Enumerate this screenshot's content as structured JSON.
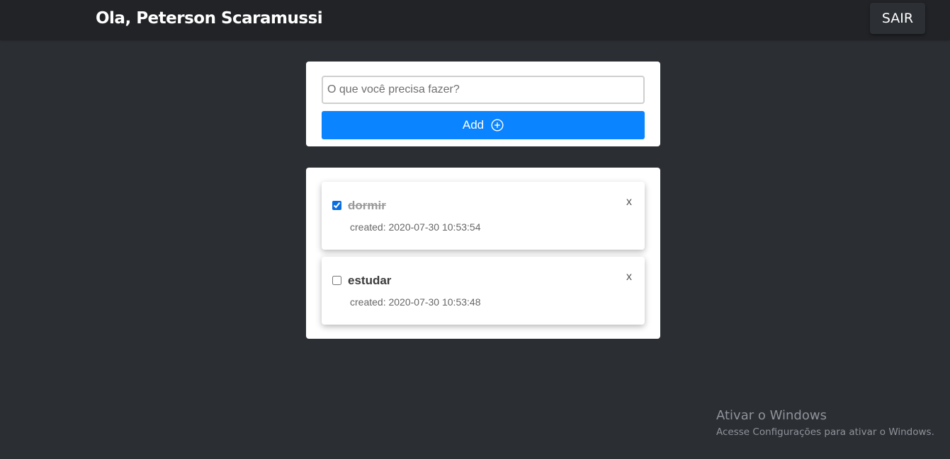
{
  "header": {
    "greeting": "Ola, Peterson Scaramussi",
    "logout_label": "SAIR"
  },
  "form": {
    "input_placeholder": "O que você precisa fazer?",
    "input_value": "",
    "add_label": "Add",
    "add_icon": "plus-circle-icon"
  },
  "todos": [
    {
      "title": "dormir",
      "completed": true,
      "created": "created: 2020-07-30 10:53:54",
      "delete_label": "x"
    },
    {
      "title": "estudar",
      "completed": false,
      "created": "created: 2020-07-30 10:53:48",
      "delete_label": "x"
    }
  ],
  "watermark": {
    "title": "Ativar o Windows",
    "subtitle": "Acesse Configurações para ativar o Windows."
  },
  "colors": {
    "background": "#2b2e33",
    "header": "#212326",
    "primary_button": "#0a84ff",
    "card": "#ffffff"
  }
}
